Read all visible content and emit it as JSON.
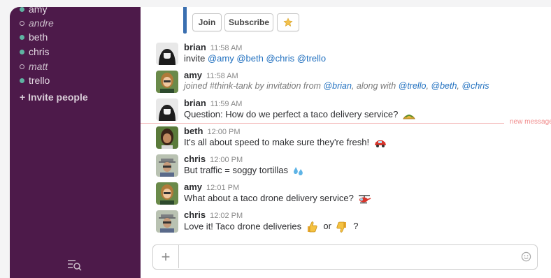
{
  "sidebar": {
    "direct_messages": [
      {
        "name": "amy",
        "status": "online"
      },
      {
        "name": "andre",
        "status": "away"
      },
      {
        "name": "beth",
        "status": "online"
      },
      {
        "name": "chris",
        "status": "online"
      },
      {
        "name": "matt",
        "status": "away"
      },
      {
        "name": "trello",
        "status": "online"
      }
    ],
    "invite_label": "+ Invite people",
    "footer_icon": "search-list-icon"
  },
  "channel_header": {
    "join_label": "Join",
    "subscribe_label": "Subscribe",
    "star_icon": "star-icon"
  },
  "messages": [
    {
      "user": "brian",
      "time": "11:58 AM",
      "text_parts": [
        "invite ",
        "@amy",
        " ",
        "@beth",
        " ",
        "@chris",
        " ",
        "@trello"
      ]
    },
    {
      "user": "amy",
      "time": "11:58 AM",
      "system": true,
      "text_parts": [
        "joined #think-tank by invitation from ",
        "@brian",
        ", along with ",
        "@trello",
        ", ",
        "@beth",
        ", ",
        "@chris"
      ]
    },
    {
      "user": "brian",
      "time": "11:59 AM",
      "text": "Question: How do we perfect a taco delivery service?",
      "emoji": "taco-icon"
    },
    {
      "user": "beth",
      "time": "12:00 PM",
      "text": "It's all about speed to make sure they're fresh!",
      "emoji": "car-icon"
    },
    {
      "user": "chris",
      "time": "12:00 PM",
      "text": "But traffic = soggy tortillas",
      "emoji": "sweat-drops-icon"
    },
    {
      "user": "amy",
      "time": "12:01 PM",
      "text": "What about a taco drone delivery service?",
      "emoji": "helicopter-icon"
    },
    {
      "user": "chris",
      "time": "12:02 PM",
      "text_a": "Love it! Taco drone deliveries",
      "text_b": "or",
      "text_c": "?",
      "emoji_a": "thumbs-up-icon",
      "emoji_b": "thumbs-down-icon"
    }
  ],
  "new_messages_label": "new messages",
  "composer": {
    "placeholder": "",
    "value": "",
    "add_icon": "plus-icon",
    "emoji_icon": "smiley-icon"
  },
  "colors": {
    "sidebar_bg": "#4d1a4a",
    "mention": "#1f6fbf",
    "online": "#5fb3a2",
    "new_messages": "#f08c8c"
  }
}
